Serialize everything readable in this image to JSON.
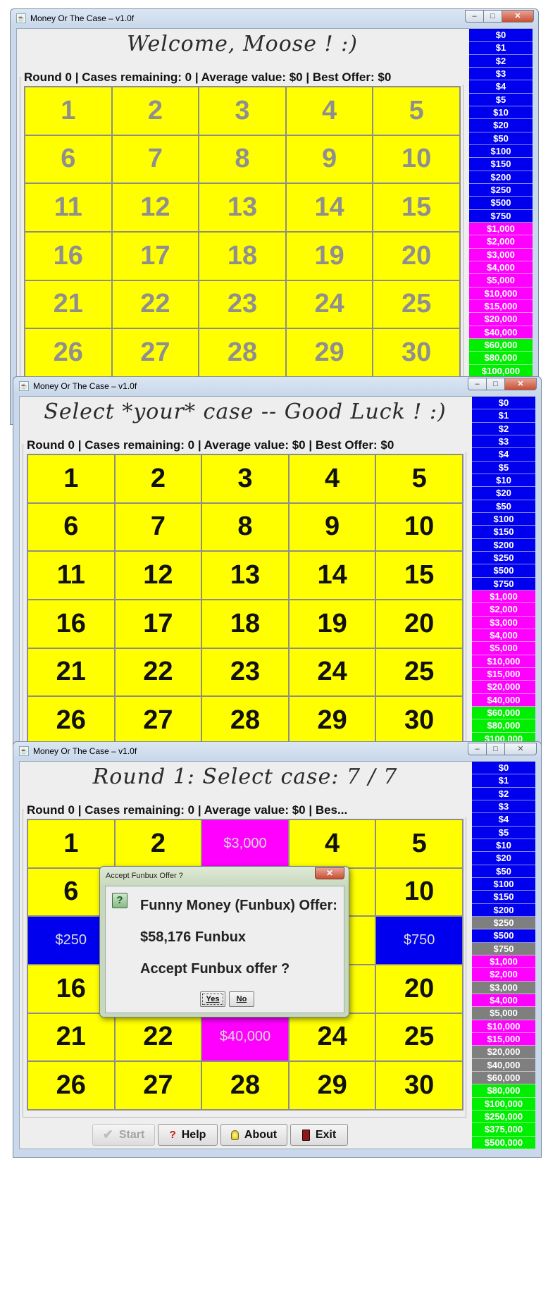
{
  "app_title": "Money Or The Case – v1.0f",
  "caption": {
    "minimize": "–",
    "maximize": "□",
    "close": "✕"
  },
  "icons": {
    "start": "check-icon",
    "help": "question-icon",
    "about": "lightbulb-icon",
    "exit": "door-icon"
  },
  "colors": {
    "case_yellow": "#ffff00",
    "money_blue": "#0000ee",
    "money_pink": "#ff00ff",
    "money_green": "#00ee00",
    "money_grey": "#7f7f7f"
  },
  "buttons": {
    "start": "Start",
    "help": "Help",
    "about": "About",
    "exit": "Exit"
  },
  "money_values": [
    "$0",
    "$1",
    "$2",
    "$3",
    "$4",
    "$5",
    "$10",
    "$20",
    "$50",
    "$100",
    "$150",
    "$200",
    "$250",
    "$500",
    "$750",
    "$1,000",
    "$2,000",
    "$3,000",
    "$4,000",
    "$5,000",
    "$10,000",
    "$15,000",
    "$20,000",
    "$40,000",
    "$60,000",
    "$80,000",
    "$100,000",
    "$250,000",
    "$375,000",
    "$500,000"
  ],
  "case_numbers": [
    "1",
    "2",
    "3",
    "4",
    "5",
    "6",
    "7",
    "8",
    "9",
    "10",
    "11",
    "12",
    "13",
    "14",
    "15",
    "16",
    "17",
    "18",
    "19",
    "20",
    "21",
    "22",
    "23",
    "24",
    "25",
    "26",
    "27",
    "28",
    "29",
    "30"
  ],
  "windows": [
    {
      "heading": "Welcome, Moose !  :)",
      "status": "Round 0  |  Cases remaining: 0  |  Average value: $0  |  Best Offer: $0",
      "start_enabled": true,
      "numbers_dimmed": true
    },
    {
      "heading": "Select *your* case -- Good Luck ! :)",
      "status": "Round 0  |  Cases remaining: 0  |  Average value: $0  |  Best Offer: $0",
      "start_enabled": false,
      "numbers_dimmed": false
    },
    {
      "heading": "Round 1: Select case: 7 / 7",
      "status": "Round 0  |  Cases remaining: 0  |  Average value: $0  |  Bes...",
      "start_enabled": false,
      "numbers_dimmed": false,
      "opened_cases": [
        {
          "case": "3",
          "value": "$3,000",
          "color": "pink"
        },
        {
          "case": "11",
          "value": "$250",
          "color": "blue"
        },
        {
          "case": "15",
          "value": "$750",
          "color": "blue"
        },
        {
          "case": "23",
          "value": "$40,000",
          "color": "pink"
        }
      ],
      "eliminated_values": [
        "$250",
        "$750",
        "$3,000",
        "$5,000",
        "$20,000",
        "$40,000",
        "$60,000"
      ],
      "dialog": {
        "title": "Accept Funbux Offer ?",
        "close": "✕",
        "question_icon": "?",
        "line1": "Funny Money (Funbux) Offer:",
        "line2": "$58,176 Funbux",
        "line3": "Accept Funbux offer ?",
        "yes": "Yes",
        "no": "No"
      }
    }
  ]
}
